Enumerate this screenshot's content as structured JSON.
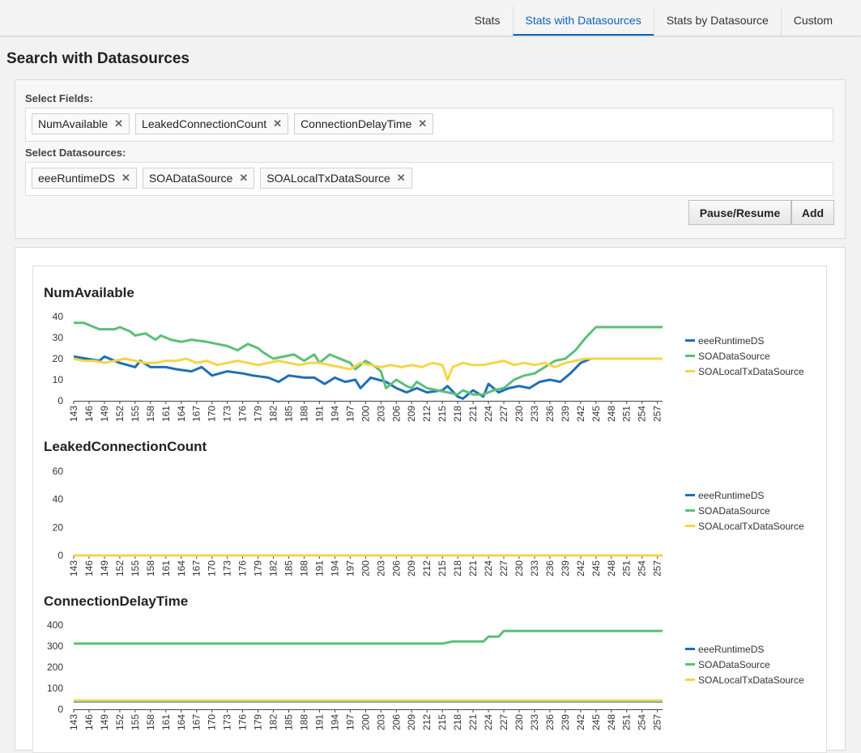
{
  "tabs": [
    {
      "label": "Stats",
      "active": false
    },
    {
      "label": "Stats with Datasources",
      "active": true
    },
    {
      "label": "Stats by Datasource",
      "active": false
    },
    {
      "label": "Custom",
      "active": false
    }
  ],
  "page_title": "Search with Datasources",
  "select_fields": {
    "label": "Select Fields:",
    "tags": [
      "NumAvailable",
      "LeakedConnectionCount",
      "ConnectionDelayTime"
    ],
    "remove_glyph": "✕"
  },
  "select_datasources": {
    "label": "Select Datasources:",
    "tags": [
      "eeeRuntimeDS",
      "SOADataSource",
      "SOALocalTxDataSource"
    ],
    "remove_glyph": "✕"
  },
  "buttons": {
    "pause_resume": "Pause/Resume",
    "add": "Add"
  },
  "colors": {
    "eeeRuntimeDS": "#1f6fb5",
    "SOADataSource": "#5cbf7a",
    "SOALocalTxDataSource": "#f5d547",
    "active_tab": "#0b65b5"
  },
  "chart_data": [
    {
      "type": "line",
      "title": "NumAvailable",
      "x_ticks": [
        143,
        146,
        149,
        152,
        155,
        158,
        161,
        164,
        167,
        170,
        173,
        176,
        179,
        182,
        185,
        188,
        191,
        194,
        197,
        200,
        203,
        206,
        209,
        212,
        215,
        218,
        221,
        224,
        227,
        230,
        233,
        236,
        239,
        242,
        245,
        248,
        251,
        254,
        257
      ],
      "x_range": [
        143,
        258
      ],
      "ylim": [
        0,
        40
      ],
      "y_ticks": [
        0,
        10,
        20,
        30,
        40
      ],
      "legend_position": "right",
      "series": [
        {
          "name": "eeeRuntimeDS",
          "points": [
            [
              143,
              21
            ],
            [
              148,
              19
            ],
            [
              149,
              21
            ],
            [
              152,
              18
            ],
            [
              155,
              16
            ],
            [
              156,
              19
            ],
            [
              158,
              16
            ],
            [
              161,
              16
            ],
            [
              163,
              15
            ],
            [
              166,
              14
            ],
            [
              168,
              16
            ],
            [
              170,
              12
            ],
            [
              173,
              14
            ],
            [
              176,
              13
            ],
            [
              178,
              12
            ],
            [
              181,
              11
            ],
            [
              183,
              9
            ],
            [
              185,
              12
            ],
            [
              188,
              11
            ],
            [
              190,
              11
            ],
            [
              192,
              8
            ],
            [
              194,
              11
            ],
            [
              196,
              9
            ],
            [
              198,
              10
            ],
            [
              199,
              6
            ],
            [
              201,
              11
            ],
            [
              204,
              9
            ],
            [
              206,
              6
            ],
            [
              208,
              4
            ],
            [
              210,
              6
            ],
            [
              212,
              4
            ],
            [
              215,
              5
            ],
            [
              216,
              7
            ],
            [
              218,
              2
            ],
            [
              219,
              1
            ],
            [
              221,
              5
            ],
            [
              223,
              2
            ],
            [
              224,
              8
            ],
            [
              226,
              4
            ],
            [
              228,
              6
            ],
            [
              230,
              7
            ],
            [
              232,
              6
            ],
            [
              234,
              9
            ],
            [
              236,
              10
            ],
            [
              238,
              9
            ],
            [
              240,
              13
            ],
            [
              242,
              18
            ],
            [
              244,
              20
            ],
            [
              258,
              20
            ]
          ]
        },
        {
          "name": "SOADataSource",
          "points": [
            [
              143,
              37
            ],
            [
              145,
              37
            ],
            [
              148,
              34
            ],
            [
              151,
              34
            ],
            [
              152,
              35
            ],
            [
              154,
              33
            ],
            [
              155,
              31
            ],
            [
              157,
              32
            ],
            [
              159,
              29
            ],
            [
              160,
              31
            ],
            [
              162,
              29
            ],
            [
              164,
              28
            ],
            [
              166,
              29
            ],
            [
              169,
              28
            ],
            [
              171,
              27
            ],
            [
              173,
              26
            ],
            [
              175,
              24
            ],
            [
              177,
              27
            ],
            [
              179,
              25
            ],
            [
              180,
              23
            ],
            [
              182,
              20
            ],
            [
              184,
              21
            ],
            [
              186,
              22
            ],
            [
              188,
              19
            ],
            [
              190,
              22
            ],
            [
              191,
              18
            ],
            [
              193,
              22
            ],
            [
              195,
              20
            ],
            [
              197,
              18
            ],
            [
              198,
              15
            ],
            [
              200,
              19
            ],
            [
              202,
              16
            ],
            [
              203,
              14
            ],
            [
              204,
              6
            ],
            [
              206,
              10
            ],
            [
              208,
              7
            ],
            [
              209,
              6
            ],
            [
              210,
              9
            ],
            [
              212,
              6
            ],
            [
              214,
              5
            ],
            [
              216,
              4
            ],
            [
              218,
              3
            ],
            [
              219,
              5
            ],
            [
              221,
              3
            ],
            [
              223,
              3
            ],
            [
              225,
              5
            ],
            [
              227,
              6
            ],
            [
              229,
              10
            ],
            [
              231,
              12
            ],
            [
              233,
              13
            ],
            [
              235,
              16
            ],
            [
              237,
              19
            ],
            [
              239,
              20
            ],
            [
              241,
              24
            ],
            [
              243,
              30
            ],
            [
              245,
              35
            ],
            [
              258,
              35
            ]
          ]
        },
        {
          "name": "SOALocalTxDataSource",
          "points": [
            [
              143,
              20
            ],
            [
              145,
              19
            ],
            [
              147,
              19
            ],
            [
              149,
              18
            ],
            [
              151,
              19
            ],
            [
              153,
              20
            ],
            [
              155,
              19
            ],
            [
              157,
              18
            ],
            [
              159,
              18
            ],
            [
              161,
              19
            ],
            [
              163,
              19
            ],
            [
              165,
              20
            ],
            [
              167,
              18
            ],
            [
              169,
              19
            ],
            [
              171,
              17
            ],
            [
              173,
              18
            ],
            [
              175,
              19
            ],
            [
              177,
              18
            ],
            [
              179,
              17
            ],
            [
              181,
              18
            ],
            [
              183,
              19
            ],
            [
              185,
              18
            ],
            [
              187,
              17
            ],
            [
              189,
              18
            ],
            [
              191,
              18
            ],
            [
              193,
              17
            ],
            [
              195,
              16
            ],
            [
              197,
              15
            ],
            [
              199,
              18
            ],
            [
              201,
              17
            ],
            [
              203,
              16
            ],
            [
              205,
              17
            ],
            [
              207,
              16
            ],
            [
              209,
              17
            ],
            [
              211,
              16
            ],
            [
              213,
              18
            ],
            [
              215,
              17
            ],
            [
              216,
              10
            ],
            [
              217,
              16
            ],
            [
              219,
              18
            ],
            [
              221,
              17
            ],
            [
              223,
              17
            ],
            [
              225,
              18
            ],
            [
              227,
              19
            ],
            [
              229,
              17
            ],
            [
              231,
              18
            ],
            [
              233,
              17
            ],
            [
              235,
              18
            ],
            [
              237,
              16
            ],
            [
              239,
              18
            ],
            [
              241,
              19
            ],
            [
              243,
              20
            ],
            [
              258,
              20
            ]
          ]
        }
      ]
    },
    {
      "type": "line",
      "title": "LeakedConnectionCount",
      "x_ticks": [
        143,
        146,
        149,
        152,
        155,
        158,
        161,
        164,
        167,
        170,
        173,
        176,
        179,
        182,
        185,
        188,
        191,
        194,
        197,
        200,
        203,
        206,
        209,
        212,
        215,
        218,
        221,
        224,
        227,
        230,
        233,
        236,
        239,
        242,
        245,
        248,
        251,
        254,
        257
      ],
      "x_range": [
        143,
        258
      ],
      "ylim": [
        0,
        60
      ],
      "y_ticks": [
        0,
        20,
        40,
        60
      ],
      "legend_position": "right",
      "series": [
        {
          "name": "eeeRuntimeDS",
          "points": [
            [
              143,
              0
            ],
            [
              258,
              0
            ]
          ]
        },
        {
          "name": "SOADataSource",
          "points": [
            [
              143,
              0
            ],
            [
              258,
              0
            ]
          ]
        },
        {
          "name": "SOALocalTxDataSource",
          "points": [
            [
              143,
              0
            ],
            [
              258,
              0
            ]
          ]
        }
      ]
    },
    {
      "type": "line",
      "title": "ConnectionDelayTime",
      "x_ticks": [
        143,
        146,
        149,
        152,
        155,
        158,
        161,
        164,
        167,
        170,
        173,
        176,
        179,
        182,
        185,
        188,
        191,
        194,
        197,
        200,
        203,
        206,
        209,
        212,
        215,
        218,
        221,
        224,
        227,
        230,
        233,
        236,
        239,
        242,
        245,
        248,
        251,
        254,
        257
      ],
      "x_range": [
        143,
        258
      ],
      "ylim": [
        0,
        400
      ],
      "y_ticks": [
        0,
        100,
        200,
        300,
        400
      ],
      "legend_position": "right",
      "series": [
        {
          "name": "eeeRuntimeDS",
          "points": [
            [
              143,
              38
            ],
            [
              258,
              38
            ]
          ]
        },
        {
          "name": "SOADataSource",
          "points": [
            [
              143,
              312
            ],
            [
              215,
              312
            ],
            [
              217,
              322
            ],
            [
              223,
              322
            ],
            [
              224,
              345
            ],
            [
              226,
              345
            ],
            [
              227,
              372
            ],
            [
              258,
              372
            ]
          ]
        },
        {
          "name": "SOALocalTxDataSource",
          "points": [
            [
              143,
              42
            ],
            [
              258,
              42
            ]
          ]
        }
      ]
    }
  ]
}
